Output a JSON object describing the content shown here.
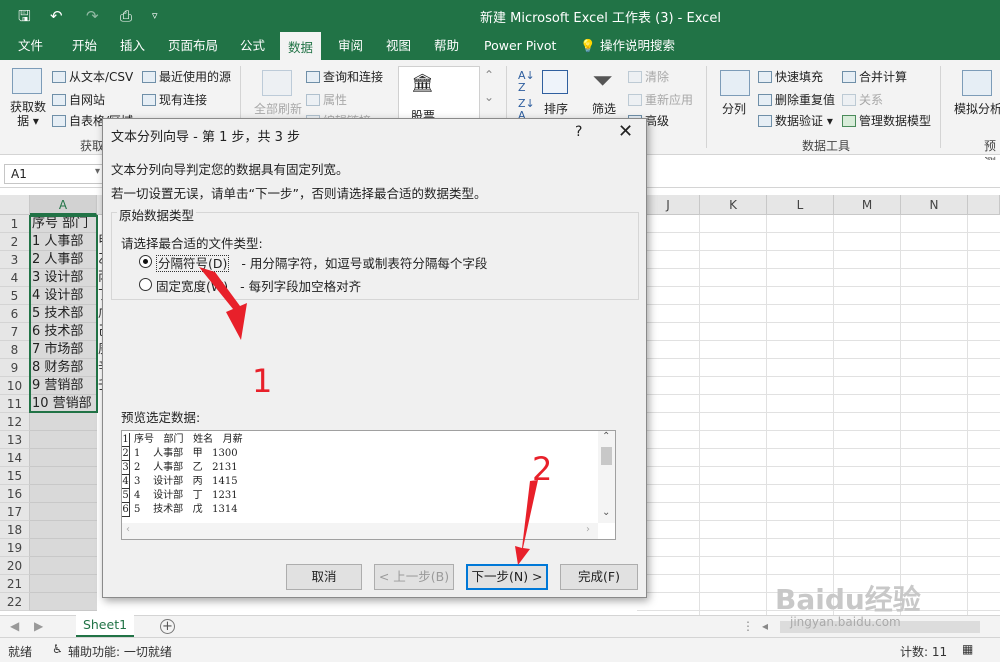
{
  "window": {
    "title": "新建 Microsoft Excel 工作表 (3) - Excel",
    "qa_icons": [
      "save-icon",
      "undo-icon",
      "redo-icon",
      "print-preview-icon",
      "customize-icon"
    ]
  },
  "tabs": [
    "文件",
    "开始",
    "插入",
    "页面布局",
    "公式",
    "数据",
    "审阅",
    "视图",
    "帮助",
    "Power Pivot",
    "操作说明搜索"
  ],
  "active_tab": "数据",
  "ribbon": {
    "get_data": "获取数据",
    "get_data_line1": "获取数",
    "get_data_line2": "据",
    "from_text_csv": "从文本/CSV",
    "from_web": "自网站",
    "from_table": "自表格/区域",
    "recent_sources": "最近使用的源",
    "existing_connections": "现有连接",
    "group_get": "获取",
    "refresh_all": "全部刷新",
    "queries_connections": "查询和连接",
    "properties": "属性",
    "edit_links": "编辑链接",
    "stocks": "股票",
    "sort": "排序",
    "filter": "筛选",
    "clear": "清除",
    "reapply": "重新应用",
    "advanced": "高级",
    "text_to_columns": "分列",
    "flash_fill": "快速填充",
    "remove_duplicates": "删除重复值",
    "data_validation": "数据验证",
    "consolidate": "合并计算",
    "relationships": "关系",
    "manage_model": "管理数据模型",
    "group_data_tools": "数据工具",
    "whatif": "模拟分析",
    "forecast": "预测"
  },
  "formula_bar": {
    "name_box": "A1"
  },
  "columns": [
    "A",
    "J",
    "K",
    "L",
    "M",
    "N"
  ],
  "rows": [
    "1",
    "2",
    "3",
    "4",
    "5",
    "6",
    "7",
    "8",
    "9",
    "10",
    "11",
    "12",
    "13",
    "14",
    "15",
    "16",
    "17",
    "18",
    "19",
    "20",
    "21",
    "22"
  ],
  "cells_A": [
    "序号 部门",
    "1 人事部",
    "2 人事部",
    "3 设计部",
    "4 设计部",
    "5 技术部",
    "6 技术部",
    "7 市场部",
    "8 财务部",
    "9 营销部",
    "10 营销部"
  ],
  "cells_B_peek": [
    "",
    "甲",
    "乙",
    "丙",
    "丁",
    "戊",
    "己",
    "庚",
    "辛",
    "壬",
    ""
  ],
  "dialog": {
    "title": "文本分列向导 - 第 1 步，共 3 步",
    "help": "?",
    "close": "✕",
    "line1": "文本分列向导判定您的数据具有固定列宽。",
    "line2": "若一切设置无误，请单击“下一步”，否则请选择最合适的数据类型。",
    "group_label": "原始数据类型",
    "prompt": "请选择最合适的文件类型:",
    "opt1_label": "分隔符号(D)",
    "opt1_desc": "- 用分隔字符，如逗号或制表符分隔每个字段",
    "opt2_label": "固定宽度(W)",
    "opt2_desc": "- 每列字段加空格对齐",
    "selected_option": "分隔符号(D)",
    "preview_label": "预览选定数据:",
    "preview_rows": [
      {
        "n": "1",
        "t": "序号   部门   姓名   月薪"
      },
      {
        "n": "2",
        "t": "1    人事部   甲   1300"
      },
      {
        "n": "3",
        "t": "2    人事部   乙   2131"
      },
      {
        "n": "4",
        "t": "3    设计部   丙   1415"
      },
      {
        "n": "5",
        "t": "4    设计部   丁   1231"
      },
      {
        "n": "6",
        "t": "5    技术部   戊   1314"
      }
    ],
    "cancel": "取消",
    "back": "< 上一步(B)",
    "next": "下一步(N) >",
    "finish": "完成(F)"
  },
  "annotations": {
    "one": "1",
    "two": "2"
  },
  "sheet_tab": "Sheet1",
  "add_sheet": "+",
  "status": {
    "ready": "就绪",
    "accessibility": "辅助功能: 一切就绪",
    "count": "计数: 11"
  },
  "watermark": {
    "logo": "Baidu经验",
    "url": "jingyan.baidu.com"
  },
  "colors": {
    "excel_green": "#217346",
    "annotation_red": "#e8202a",
    "dialog_bg": "#f0f0f0"
  }
}
